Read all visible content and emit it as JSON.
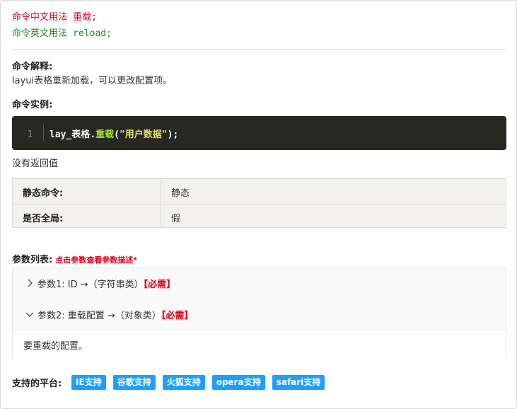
{
  "command": {
    "cn_label": "命令中文用法",
    "cn_value": "重载;",
    "en_label": "命令英文用法",
    "en_value": "reload;"
  },
  "explain": {
    "title": "命令解释:",
    "text": "layui表格重新加载，可以更改配置项。"
  },
  "example": {
    "title": "命令实例:",
    "line_number": "1",
    "code_obj": "lay_表格.",
    "code_fn": "重载",
    "code_open": "(",
    "code_str": "\"用户数据\"",
    "code_close": ");"
  },
  "return_text": "没有返回值",
  "props": [
    {
      "key": "静态命令:",
      "value": "静态"
    },
    {
      "key": "是否全局:",
      "value": "假"
    }
  ],
  "params": {
    "title": "参数列表:",
    "note": "点击参数查看参数描述*",
    "items": [
      {
        "label": "参数1: ID →（字符串类）",
        "required": "【必需】",
        "expanded": false
      },
      {
        "label": "参数2: 重载配置 →（对象类）",
        "required": "【必需】",
        "expanded": true,
        "body": "要重载的配置。"
      }
    ]
  },
  "platforms": {
    "title": "支持的平台:",
    "badges": [
      "IE支持",
      "谷歌支持",
      "火狐支持",
      "opera支持",
      "safari支持"
    ],
    "badge_color": "#1e9fff"
  }
}
